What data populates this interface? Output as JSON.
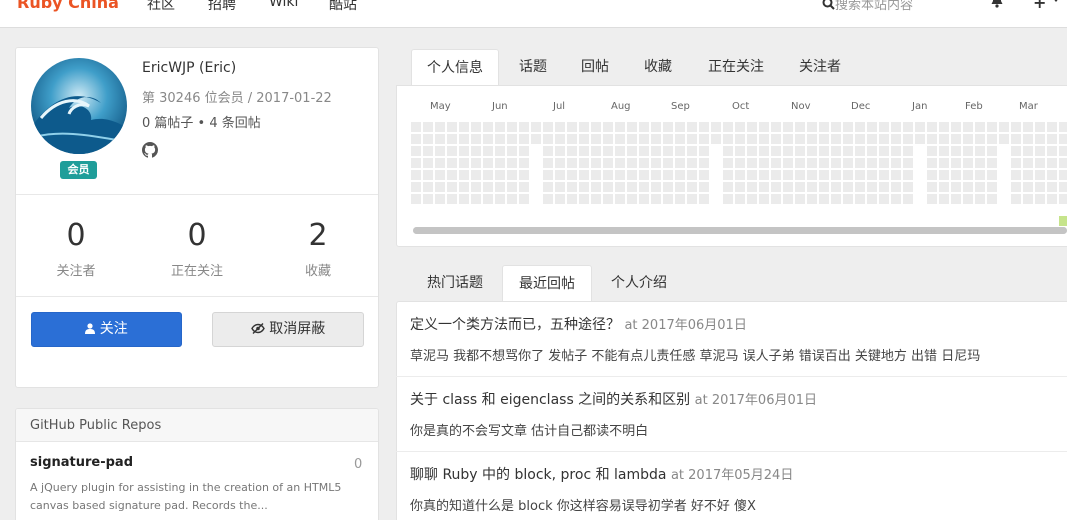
{
  "nav": {
    "brand": "Ruby China",
    "links": [
      "社区",
      "招聘",
      "Wiki",
      "酷站"
    ],
    "search_placeholder": "搜索本站内容"
  },
  "profile": {
    "name": "EricWJP (Eric)",
    "member_line": "第 30246 位会员 / 2017-01-22",
    "posts_line": "0 篇帖子 • 4 条回帖",
    "badge": "会员",
    "stats": [
      {
        "value": "0",
        "label": "关注者"
      },
      {
        "value": "0",
        "label": "正在关注"
      },
      {
        "value": "2",
        "label": "收藏"
      }
    ],
    "follow_button": "关注",
    "unblock_button": "取消屏蔽"
  },
  "repos": {
    "title": "GitHub Public Repos",
    "items": [
      {
        "name": "signature-pad",
        "count": "0",
        "description": "A jQuery plugin for assisting in the creation of an HTML5 canvas based signature pad. Records the..."
      }
    ]
  },
  "main_tabs": [
    "个人信息",
    "话题",
    "回帖",
    "收藏",
    "正在关注",
    "关注者"
  ],
  "calendar": {
    "months": [
      "May",
      "Jun",
      "Jul",
      "Aug",
      "Sep",
      "Oct",
      "Nov",
      "Dec",
      "Jan",
      "Feb",
      "Mar"
    ]
  },
  "activity_tabs": [
    "热门话题",
    "最近回帖",
    "个人介绍"
  ],
  "replies": [
    {
      "title": "定义一个类方法而已，五种途径？",
      "time": "at 2017年06月01日",
      "body": "草泥马 我都不想骂你了 发帖子 不能有点儿责任感 草泥马 误人子弟 错误百出 关键地方 出错 日尼玛"
    },
    {
      "title": "关于 class 和 eigenclass 之间的关系和区别",
      "time": "at 2017年06月01日",
      "body": "你是真的不会写文章 估计自己都读不明白"
    },
    {
      "title": "聊聊 Ruby 中的 block, proc 和 lambda",
      "time": "at 2017年05月24日",
      "body": "你真的知道什么是 block 你这样容易误导初学者 好不好 傻X"
    }
  ],
  "colors": {
    "brand": "#eb5424",
    "primary": "#2b6fd6",
    "badge": "#1f9e9a",
    "calendar_empty": "#ebebeb",
    "calendar_active": "#c6e48b"
  }
}
